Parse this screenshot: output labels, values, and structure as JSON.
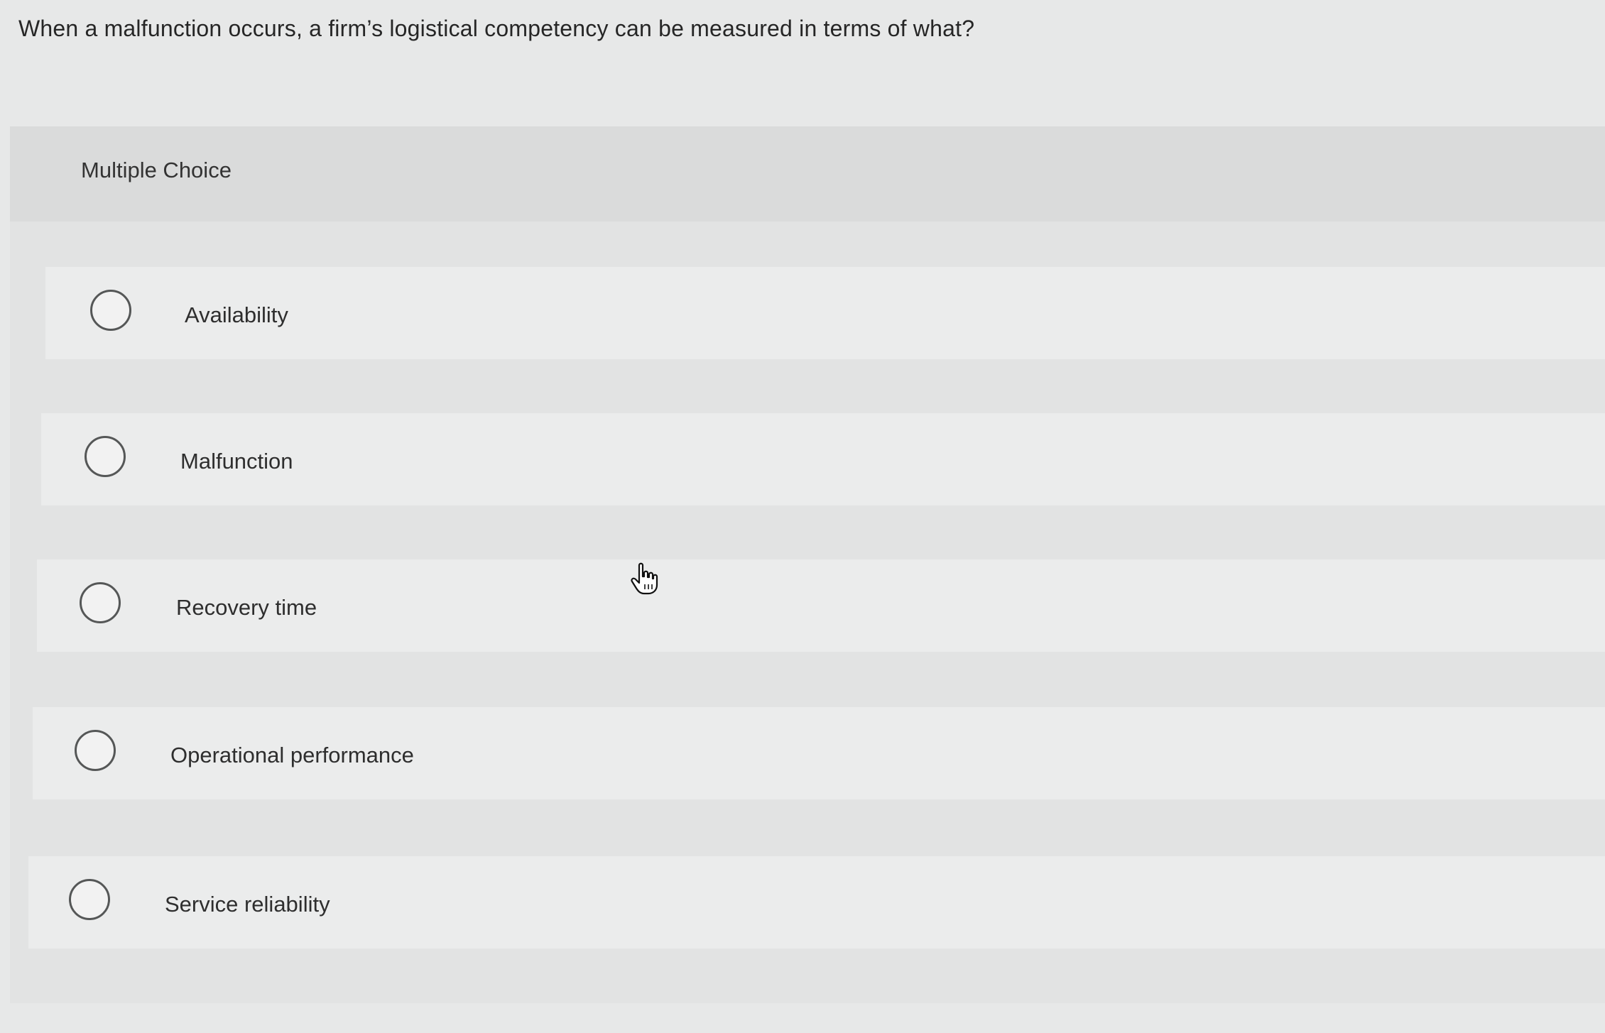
{
  "question": {
    "text": "When a malfunction occurs, a firm’s logistical competency can be measured in terms of what?"
  },
  "panel": {
    "title": "Multiple Choice"
  },
  "options": [
    {
      "label": "Availability"
    },
    {
      "label": "Malfunction"
    },
    {
      "label": "Recovery time"
    },
    {
      "label": "Operational performance"
    },
    {
      "label": "Service reliability"
    }
  ],
  "cursor": {
    "icon": "hand-pointer-icon"
  }
}
